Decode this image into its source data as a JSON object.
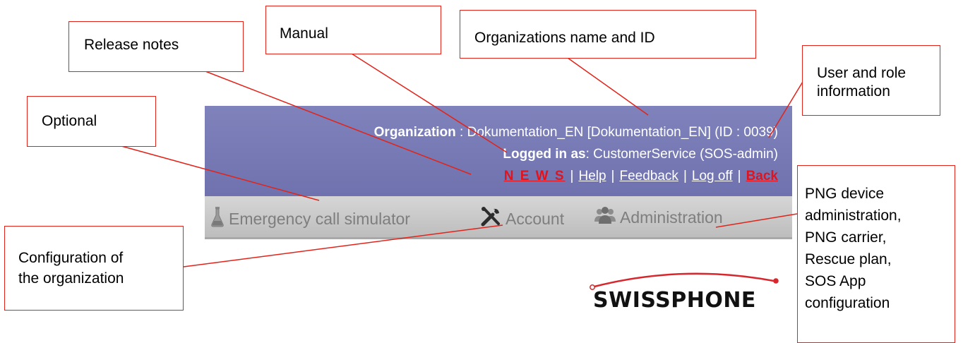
{
  "header": {
    "organization_label": "Organization",
    "organization_value": " : Dokumentation_EN [Dokumentation_EN] (ID : 0039)",
    "logged_label": "Logged in as",
    "logged_value": ": CustomerService (SOS-admin)",
    "links": {
      "news": "N E W S",
      "help": "Help",
      "feedback": "Feedback",
      "logoff": "Log off",
      "back": "Back",
      "separator": "|"
    }
  },
  "tabs": {
    "simulator": "Emergency call simulator",
    "account": "Account",
    "administration": "Administration"
  },
  "annotations": {
    "release_notes": "Release notes",
    "manual": "Manual",
    "org_name_id": "Organizations name and ID",
    "user_role": [
      "User and role",
      "information"
    ],
    "optional": "Optional",
    "config_org": [
      "Configuration of",
      "the organization"
    ],
    "admin_items": [
      "PNG device",
      "administration,",
      "PNG carrier,",
      "Rescue plan,",
      "SOS App",
      "configuration"
    ]
  },
  "logo": {
    "text": "SWISSPHONE"
  },
  "colors": {
    "header_bg": "#7377b1",
    "tabs_bg": "#cccccc",
    "link_red": "#e0141e",
    "annotation_red": "#e2231a"
  },
  "icons": {
    "simulator": "flask-icon",
    "account": "tools-icon",
    "administration": "users-icon"
  }
}
